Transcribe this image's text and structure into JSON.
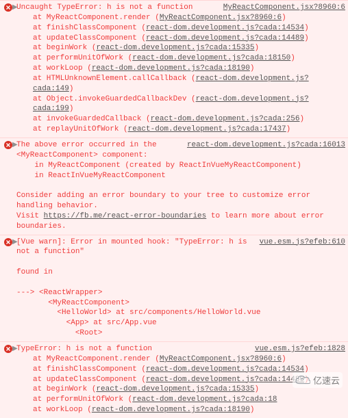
{
  "errors": [
    {
      "arrow": "▶",
      "headline": "Uncaught TypeError: h is not a function",
      "source": "MyReactComponent.jsx?8960:6",
      "stack": [
        {
          "pre": "at MyReactComponent.render (",
          "link": "MyReactComponent.jsx?8960:6",
          "post": ")"
        },
        {
          "pre": "at finishClassComponent (",
          "link": "react-dom.development.js?cada:14534",
          "post": ")"
        },
        {
          "pre": "at updateClassComponent (",
          "link": "react-dom.development.js?cada:14489",
          "post": ")"
        },
        {
          "pre": "at beginWork (",
          "link": "react-dom.development.js?cada:15335",
          "post": ")"
        },
        {
          "pre": "at performUnitOfWork (",
          "link": "react-dom.development.js?cada:18150",
          "post": ")"
        },
        {
          "pre": "at workLoop (",
          "link": "react-dom.development.js?cada:18190",
          "post": ")"
        },
        {
          "pre": "at HTMLUnknownElement.callCallback (",
          "link": "react-dom.development.js?cada:149",
          "post": ")"
        },
        {
          "pre": "at Object.invokeGuardedCallbackDev (",
          "link": "react-dom.development.js?cada:199",
          "post": ")"
        },
        {
          "pre": "at invokeGuardedCallback (",
          "link": "react-dom.development.js?cada:256",
          "post": ")"
        },
        {
          "pre": "at replayUnitOfWork (",
          "link": "react-dom.development.js?cada:17437",
          "post": ")"
        }
      ]
    },
    {
      "arrow": "▶",
      "headline": "The above error occurred in the ",
      "source": "react-dom.development.js?cada:16013",
      "bodyLines": [
        "<MyReactComponent> component:",
        "    in MyReactComponent (created by ReactInVueMyReactComponent)",
        "    in ReactInVueMyReactComponent",
        "",
        "Consider adding an error boundary to your tree to customize error handling behavior.",
        "Visit https://fb.me/react-error-boundaries to learn more about error boundaries."
      ],
      "inlineLink": "https://fb.me/react-error-boundaries"
    },
    {
      "arrow": "▶",
      "headline": "[Vue warn]: Error in mounted hook: \"TypeError: h",
      "headlineTail": " is not a function\"",
      "source": "vue.esm.js?efeb:610",
      "bodyLines": [
        "",
        "found in",
        "",
        "---> <ReactWrapper>",
        "       <MyReactComponent>",
        "         <HelloWorld> at src/components/HelloWorld.vue",
        "           <App> at src/App.vue",
        "             <Root>"
      ]
    },
    {
      "arrow": "▶",
      "headline": "TypeError: h is not a function",
      "source": "vue.esm.js?efeb:1828",
      "stack": [
        {
          "pre": "at MyReactComponent.render (",
          "link": "MyReactComponent.jsx?8960:6",
          "post": ")"
        },
        {
          "pre": "at finishClassComponent (",
          "link": "react-dom.development.js?cada:14534",
          "post": ")"
        },
        {
          "pre": "at updateClassComponent (",
          "link": "react-dom.development.js?cada:14489",
          "post": ")"
        },
        {
          "pre": "at beginWork (",
          "link": "react-dom.development.js?cada:15335",
          "post": ")"
        },
        {
          "pre": "at performUnitOfWork (",
          "link": "react-dom.development.js?cada:18",
          "post": ""
        },
        {
          "pre": "at workLoop (",
          "link": "react-dom.development.js?cada:18190",
          "post": ")"
        }
      ]
    }
  ],
  "watermark": "亿速云"
}
